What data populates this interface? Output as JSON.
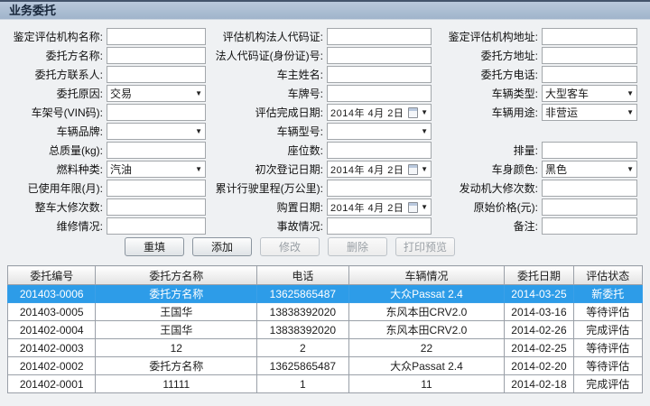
{
  "title": "业务委托",
  "form_rows": [
    [
      {
        "label": "鉴定评估机构名称:",
        "type": "text",
        "value": ""
      },
      {
        "label": "评估机构法人代码证:",
        "type": "text",
        "value": ""
      },
      {
        "label": "鉴定评估机构地址:",
        "type": "text",
        "value": ""
      }
    ],
    [
      {
        "label": "委托方名称:",
        "type": "text",
        "value": ""
      },
      {
        "label": "法人代码证(身份证)号:",
        "type": "text",
        "value": ""
      },
      {
        "label": "委托方地址:",
        "type": "text",
        "value": ""
      }
    ],
    [
      {
        "label": "委托方联系人:",
        "type": "text",
        "value": ""
      },
      {
        "label": "车主姓名:",
        "type": "text",
        "value": ""
      },
      {
        "label": "委托方电话:",
        "type": "text",
        "value": ""
      }
    ],
    [
      {
        "label": "委托原因:",
        "type": "select",
        "value": "交易"
      },
      {
        "label": "车牌号:",
        "type": "text",
        "value": ""
      },
      {
        "label": "车辆类型:",
        "type": "select",
        "value": "大型客车"
      }
    ],
    [
      {
        "label": "车架号(VIN码):",
        "type": "text",
        "value": ""
      },
      {
        "label": "评估完成日期:",
        "type": "date",
        "value": "2014年 4月 2日"
      },
      {
        "label": "车辆用途:",
        "type": "select",
        "value": "非营运"
      }
    ],
    [
      {
        "label": "车辆品牌:",
        "type": "select",
        "value": ""
      },
      {
        "label": "车辆型号:",
        "type": "select",
        "value": ""
      },
      {
        "label": "",
        "type": "none",
        "value": ""
      }
    ],
    [
      {
        "label": "总质量(kg):",
        "type": "text",
        "value": ""
      },
      {
        "label": "座位数:",
        "type": "text",
        "value": ""
      },
      {
        "label": "排量:",
        "type": "text",
        "value": ""
      }
    ],
    [
      {
        "label": "燃料种类:",
        "type": "select",
        "value": "汽油"
      },
      {
        "label": "初次登记日期:",
        "type": "date",
        "value": "2014年 4月 2日"
      },
      {
        "label": "车身颜色:",
        "type": "select",
        "value": "黑色"
      }
    ],
    [
      {
        "label": "已使用年限(月):",
        "type": "text",
        "value": ""
      },
      {
        "label": "累计行驶里程(万公里):",
        "type": "text",
        "value": ""
      },
      {
        "label": "发动机大修次数:",
        "type": "text",
        "value": ""
      }
    ],
    [
      {
        "label": "整车大修次数:",
        "type": "text",
        "value": ""
      },
      {
        "label": "购置日期:",
        "type": "date",
        "value": "2014年 4月 2日"
      },
      {
        "label": "原始价格(元):",
        "type": "text",
        "value": ""
      }
    ],
    [
      {
        "label": "维修情况:",
        "type": "text",
        "value": ""
      },
      {
        "label": "事故情况:",
        "type": "text",
        "value": ""
      },
      {
        "label": "备注:",
        "type": "text",
        "value": ""
      }
    ]
  ],
  "buttons": [
    {
      "label": "重填",
      "enabled": true
    },
    {
      "label": "添加",
      "enabled": true
    },
    {
      "label": "修改",
      "enabled": false
    },
    {
      "label": "删除",
      "enabled": false
    },
    {
      "label": "打印预览",
      "enabled": false
    }
  ],
  "table": {
    "columns": [
      "委托编号",
      "委托方名称",
      "电话",
      "车辆情况",
      "委托日期",
      "评估状态"
    ],
    "selected_row": 0,
    "rows": [
      [
        "201403-0006",
        "委托方名称",
        "13625865487",
        "大众Passat 2.4",
        "2014-03-25",
        "新委托"
      ],
      [
        "201403-0005",
        "王国华",
        "13838392020",
        "东风本田CRV2.0",
        "2014-03-16",
        "等待评估"
      ],
      [
        "201402-0004",
        "王国华",
        "13838392020",
        "东风本田CRV2.0",
        "2014-02-26",
        "完成评估"
      ],
      [
        "201402-0003",
        "12",
        "2",
        "22",
        "2014-02-25",
        "等待评估"
      ],
      [
        "201402-0002",
        "委托方名称",
        "13625865487",
        "大众Passat 2.4",
        "2014-02-20",
        "等待评估"
      ],
      [
        "201402-0001",
        "11111",
        "1",
        "11",
        "2014-02-18",
        "完成评估"
      ]
    ]
  },
  "colors": {
    "titlebar": "#a7b9d0",
    "selection": "#2d9ce8"
  }
}
